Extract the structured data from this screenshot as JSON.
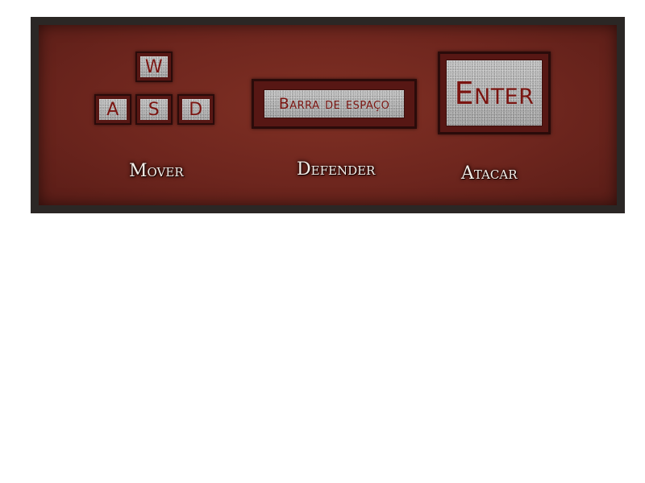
{
  "controls": {
    "move": {
      "keys": [
        "W",
        "A",
        "S",
        "D"
      ],
      "label": "Mover"
    },
    "defend": {
      "key": "Barra de espaço",
      "label": "Defender"
    },
    "attack": {
      "key": "Enter",
      "label": "Atacar"
    }
  },
  "colors": {
    "panel_frame": "#2b2725",
    "panel_background": "#6e261e",
    "key_border": "#571714",
    "key_face": "#b9b9b9",
    "key_text": "#7a1410",
    "caption_text": "#f3eee8"
  }
}
